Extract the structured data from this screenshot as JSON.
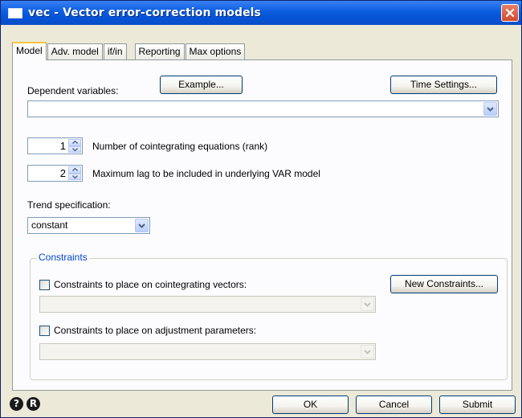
{
  "window": {
    "title": "vec - Vector error-correction models"
  },
  "tabs": [
    {
      "label": "Model"
    },
    {
      "label": "Adv. model"
    },
    {
      "label": "if/in"
    },
    {
      "label": "Reporting"
    },
    {
      "label": "Max options"
    }
  ],
  "model": {
    "dependent_label": "Dependent variables:",
    "example_button": "Example...",
    "time_settings_button": "Time Settings...",
    "dependent_value": "",
    "rank": {
      "value": "1",
      "label": "Number of cointegrating equations (rank)"
    },
    "lags": {
      "value": "2",
      "label": "Maximum lag to be included in underlying VAR model"
    },
    "trend": {
      "label": "Trend specification:",
      "value": "constant"
    },
    "constraints": {
      "legend": "Constraints",
      "cointegrating_label": "Constraints to place on cointegrating vectors:",
      "cointegrating_checked": false,
      "cointegrating_value": "",
      "new_constraints_button": "New Constraints...",
      "adjustment_label": "Constraints to place on adjustment parameters:",
      "adjustment_checked": false,
      "adjustment_value": ""
    }
  },
  "footer": {
    "help_symbol": "?",
    "reset_symbol": "R",
    "ok_button": "OK",
    "cancel_button": "Cancel",
    "submit_button": "Submit"
  },
  "colors": {
    "titlebar": "#0a5de0",
    "dialog_bg": "#ece9d8",
    "panel_bg": "#fcfcfe",
    "group_legend": "#0046d5",
    "close_button": "#d24a2c"
  }
}
